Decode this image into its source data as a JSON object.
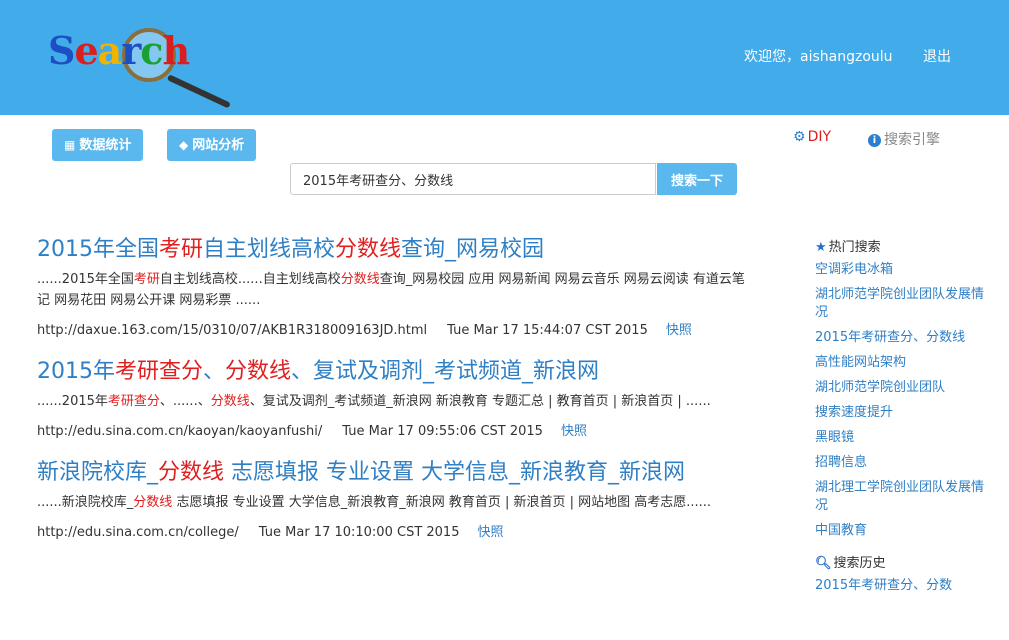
{
  "header": {
    "logo": {
      "l1": "S",
      "l2": "e",
      "l3": "a",
      "l4": "r",
      "l5": "c",
      "l6": "h"
    },
    "welcome": "欢迎您，aishangzoulu",
    "logout": "退出"
  },
  "toolbar": {
    "stats": "数据统计",
    "analysis": "网站分析",
    "diy": "DIY",
    "engines": "搜索引擎"
  },
  "search": {
    "query": "2015年考研查分、分数线",
    "button": "搜索一下"
  },
  "results": [
    {
      "title": {
        "a": "2015年全国",
        "b": "考研",
        "c": "自主划线高校",
        "d": "分数线",
        "e": "查询_网易校园"
      },
      "snippet": {
        "a": "......2015年全国",
        "b": "考研",
        "c": "自主划线高校......自主划线高校",
        "d": "分数线",
        "e": "查询_网易校园 应用 网易新闻 网易云音乐 网易云阅读 有道云笔记 网易花田 网易公开课 网易彩票 ......"
      },
      "url": "http://daxue.163.com/15/0310/07/AKB1R318009163JD.html",
      "time": "Tue Mar 17 15:44:07 CST 2015",
      "snapshot": "快照"
    },
    {
      "title": {
        "a": "2015年",
        "b": "考研查分",
        "c": "、",
        "d": "分数线",
        "e": "、复试及调剂_考试频道_新浪网"
      },
      "snippet": {
        "a": "......2015年",
        "b": "考研查分",
        "c": "、......、",
        "d": "分数线",
        "e": "、复试及调剂_考试频道_新浪网 新浪教育 专题汇总 |  教育首页 |  新浪首页 |  ......"
      },
      "url": "http://edu.sina.com.cn/kaoyan/kaoyanfushi/",
      "time": "Tue Mar 17 09:55:06 CST 2015",
      "snapshot": "快照"
    },
    {
      "title": {
        "a": "新浪院校库_",
        "b": "分数线",
        "c": " 志愿填报 专业设置 大学信息_新浪教育_新浪网"
      },
      "snippet": {
        "a": "......新浪院校库_",
        "b": "分数线",
        "c": " 志愿填报 专业设置 大学信息_新浪教育_新浪网 教育首页 |  新浪首页 |  网站地图 高考志愿......"
      },
      "url": "http://edu.sina.com.cn/college/",
      "time": "Tue Mar 17 10:10:00 CST 2015",
      "snapshot": "快照"
    }
  ],
  "sidebar": {
    "hot_title": "热门搜索",
    "hot": [
      "空调彩电冰箱",
      "湖北师范学院创业团队发展情况",
      "2015年考研查分、分数线",
      "高性能网站架构",
      "湖北师范学院创业团队",
      "搜索速度提升",
      "黑眼镜",
      "招聘信息",
      "湖北理工学院创业团队发展情况",
      "中国教育"
    ],
    "history_title": "搜索历史",
    "history": [
      "2015年考研查分、分数"
    ]
  }
}
